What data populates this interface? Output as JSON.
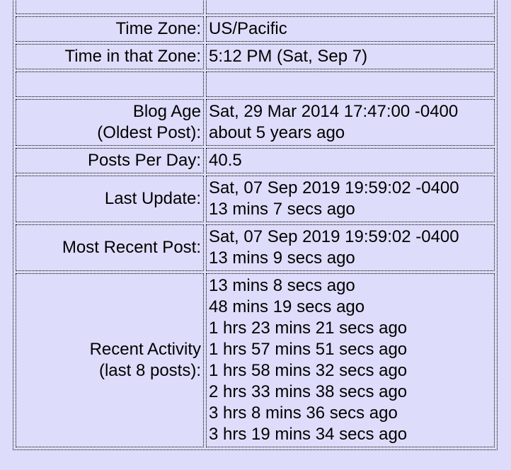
{
  "rows": {
    "time_zone": {
      "label": "Time Zone:",
      "value": "US/Pacific"
    },
    "time_in_zone": {
      "label": "Time in that Zone:",
      "value": "5:12 PM (Sat, Sep 7)"
    },
    "blog_age": {
      "label_line1": "Blog Age",
      "label_line2": "(Oldest Post):",
      "value_line1": "Sat, 29 Mar 2014 17:47:00 -0400",
      "value_line2": "about 5 years ago"
    },
    "posts_per_day": {
      "label": "Posts Per Day:",
      "value": "40.5"
    },
    "last_update": {
      "label": "Last Update:",
      "value_line1": "Sat, 07 Sep 2019 19:59:02 -0400",
      "value_line2": "13 mins 7 secs ago"
    },
    "most_recent_post": {
      "label": "Most Recent Post:",
      "value_line1": "Sat, 07 Sep 2019 19:59:02 -0400",
      "value_line2": "13 mins 9 secs ago"
    },
    "recent_activity": {
      "label_line1": "Recent Activity",
      "label_line2": "(last 8 posts):",
      "items": [
        "13 mins 8 secs ago",
        "48 mins 19 secs ago",
        "1 hrs 23 mins 21 secs ago",
        "1 hrs 57 mins 51 secs ago",
        "1 hrs 58 mins 32 secs ago",
        "2 hrs 33 mins 38 secs ago",
        "3 hrs 8 mins 36 secs ago",
        "3 hrs 19 mins 34 secs ago"
      ]
    }
  }
}
